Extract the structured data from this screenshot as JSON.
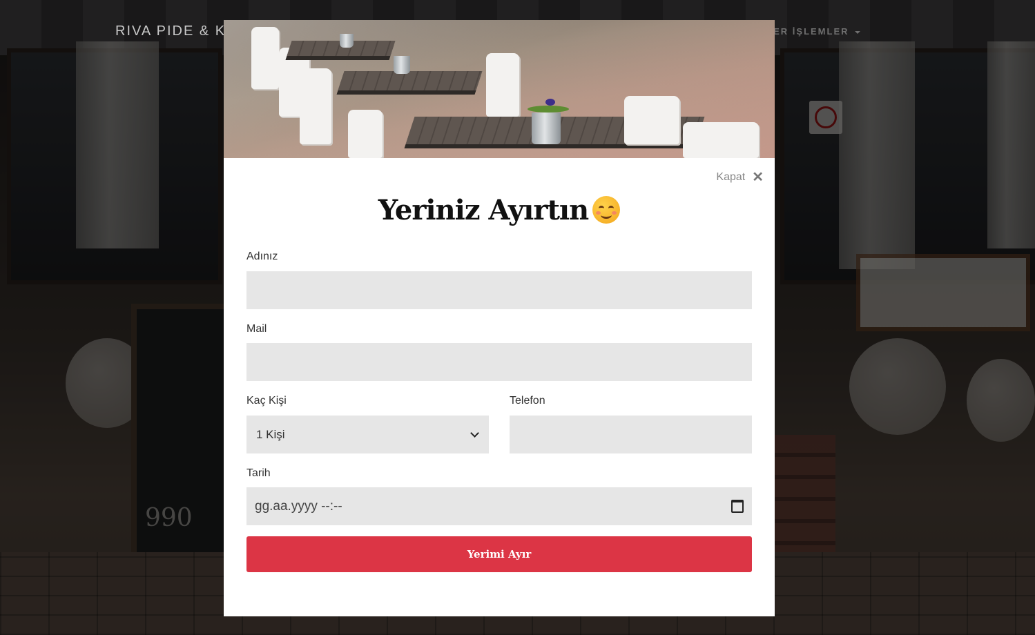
{
  "nav": {
    "brand": "RIVA PIDE & K",
    "menu_right": "GER İŞLEMLER"
  },
  "modal": {
    "close_label": "Kapat",
    "close_icon": "close-icon",
    "title": "Yeriniz Ayırtın",
    "title_emoji": "smiling-face-icon",
    "fields": {
      "name_label": "Adınız",
      "name_value": "",
      "mail_label": "Mail",
      "mail_value": "",
      "guests_label": "Kaç Kişi",
      "guests_selected": "1 Kişi",
      "phone_label": "Telefon",
      "phone_value": "",
      "date_label": "Tarih",
      "date_placeholder": "gg.aa.yyyy --:--"
    },
    "submit_label": "Yerimi Ayır"
  },
  "colors": {
    "accent": "#dc3545",
    "input_bg": "#e6e6e6",
    "overlay": "rgba(0,0,0,0.55)"
  }
}
